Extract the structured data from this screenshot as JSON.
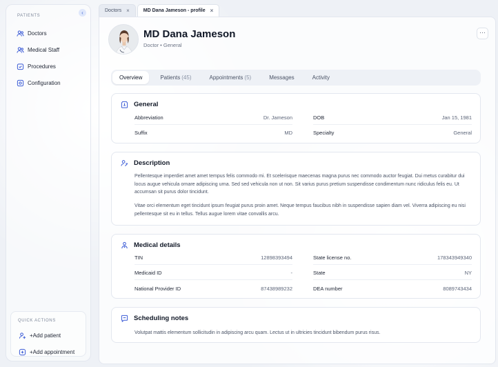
{
  "sidebar": {
    "section_label": "PATIENTS",
    "items": [
      {
        "label": "Doctors",
        "icon": "users-icon"
      },
      {
        "label": "Medical Staff",
        "icon": "users-icon"
      },
      {
        "label": "Procedures",
        "icon": "clipboard-icon"
      },
      {
        "label": "Configuration",
        "icon": "gear-icon"
      }
    ],
    "quick_actions": {
      "label": "QUICK ACTIONS",
      "items": [
        {
          "label": "+Add patient",
          "icon": "add-user-icon"
        },
        {
          "label": "+Add appointment",
          "icon": "calendar-plus-icon"
        }
      ]
    }
  },
  "tabs": [
    {
      "label": "Doctors",
      "close": "×"
    },
    {
      "label": "MD Dana Jameson - profile",
      "close": "×"
    }
  ],
  "profile": {
    "name": "MD Dana Jameson",
    "subtitle": "Doctor • General",
    "more": "···"
  },
  "segments": [
    {
      "label": "Overview",
      "count": ""
    },
    {
      "label": "Patients",
      "count": "(45)"
    },
    {
      "label": "Appointments",
      "count": "(5)"
    },
    {
      "label": "Messages",
      "count": ""
    },
    {
      "label": "Activity",
      "count": ""
    }
  ],
  "general": {
    "title": "General",
    "rows": [
      {
        "k": "Abbreviation",
        "v": "Dr. Jameson"
      },
      {
        "k": "DOB",
        "v": "Jan 15, 1981"
      },
      {
        "k": "Suffix",
        "v": "MD"
      },
      {
        "k": "Specialty",
        "v": "General"
      }
    ]
  },
  "description": {
    "title": "Description",
    "p1": "Pellentesque imperdiet amet amet tempus felis commodo mi. Et scelerisque maecenas magna purus nec commodo auctor feugiat. Dui metus curabitur dui locus augue vehicula ornare adipiscing urna. Sed sed vehicula non ut non. Sit varius purus pretium suspendisse condimentum nunc ridiculus felis eu. Ut accumsan sit purus dolor tincidunt.",
    "p2": "Vitae orci elementum eget tincidunt ipsum feugiat purus proin amet. Neque tempus faucibus nibh in suspendisse sapien diam vel. Viverra adipiscing eu nisi pellentesque sit eu in tellus. Tellus augue lorem vitae convallis arcu."
  },
  "medical": {
    "title": "Medical details",
    "rows": [
      {
        "k": "TIN",
        "v": "12898393494"
      },
      {
        "k": "State license no.",
        "v": "178343949340"
      },
      {
        "k": "Medicaid ID",
        "v": "-"
      },
      {
        "k": "State",
        "v": "NY"
      },
      {
        "k": "National Provider ID",
        "v": "87438989232"
      },
      {
        "k": "DEA number",
        "v": "8089743434"
      }
    ]
  },
  "scheduling": {
    "title": "Scheduling notes",
    "text": "Volutpat mattis elementum sollicitudin in adipiscing arcu quam. Lectus ut in ultricies tincidunt bibendum purus risus."
  },
  "colors": {
    "accent": "#3b5bd6",
    "background": "#eef1f6",
    "text": "#1e2433"
  }
}
